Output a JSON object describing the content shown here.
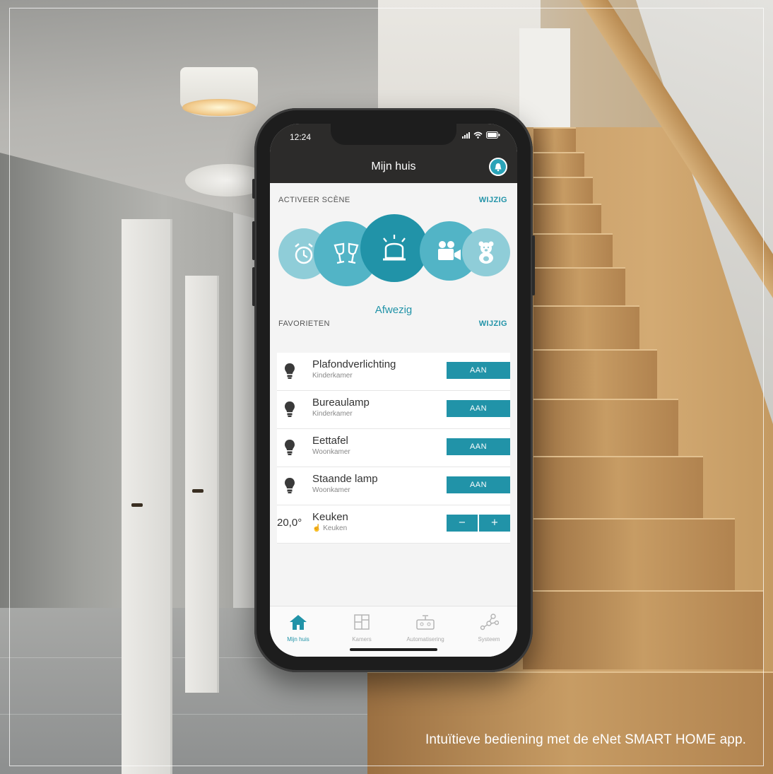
{
  "caption": "Intuïtieve bediening met de eNet SMART HOME app.",
  "phone": {
    "status_time": "12:24",
    "title": "Mijn huis",
    "icons": {
      "notification": "bell-icon"
    },
    "scenes_header": "ACTIVEER SCÈNE",
    "scenes_edit": "WIJZIG",
    "scenes": [
      {
        "name": "alarm-clock-icon"
      },
      {
        "name": "wine-glasses-icon"
      },
      {
        "name": "siren-icon",
        "active": true
      },
      {
        "name": "video-camera-icon"
      },
      {
        "name": "teddy-bear-icon"
      }
    ],
    "active_scene_label": "Afwezig",
    "favorites_header": "FAVORIETEN",
    "favorites_edit": "WIJZIG",
    "favorites": [
      {
        "title": "Plafondverlichting",
        "room": "Kinderkamer",
        "button": "AAN",
        "icon": "light-bulb-icon"
      },
      {
        "title": "Bureaulamp",
        "room": "Kinderkamer",
        "button": "AAN",
        "icon": "light-bulb-icon"
      },
      {
        "title": "Eettafel",
        "room": "Woonkamer",
        "button": "AAN",
        "icon": "light-bulb-icon"
      },
      {
        "title": "Staande lamp",
        "room": "Woonkamer",
        "button": "AAN",
        "icon": "light-bulb-icon"
      }
    ],
    "thermostat": {
      "value": "20,0°",
      "title": "Keuken",
      "room": "Keuken",
      "minus": "−",
      "plus": "+"
    },
    "tabs": [
      {
        "label": "Mijn huis",
        "icon": "home-icon",
        "active": true
      },
      {
        "label": "Kamers",
        "icon": "rooms-icon"
      },
      {
        "label": "Automatisering",
        "icon": "robot-icon"
      },
      {
        "label": "Systeem",
        "icon": "network-icon"
      }
    ]
  },
  "colors": {
    "accent": "#2193a8",
    "appbar": "#2c2b2a",
    "scene_light": "#8fcdd8",
    "scene_mid": "#52b4c6"
  }
}
